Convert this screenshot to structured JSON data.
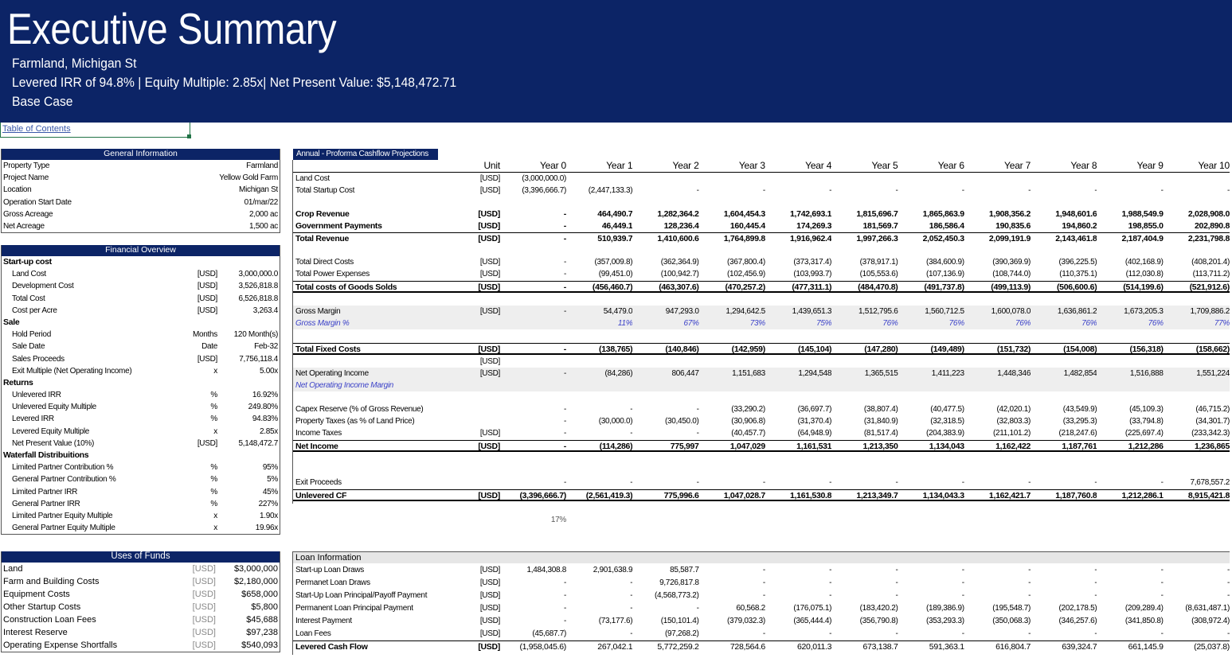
{
  "header": {
    "title": "Executive Summary",
    "location": "Farmland, Michigan St",
    "metrics": "Levered IRR of 94.8% | Equity Multiple: 2.85x| Net Present Value: $5,148,472.71",
    "scenario": "Base Case"
  },
  "toc": {
    "label": "Table of Contents"
  },
  "general": {
    "title": "General Information",
    "rows": [
      {
        "label": "Property Type",
        "value": "Farmland"
      },
      {
        "label": "Project Name",
        "value": "Yellow Gold Farm"
      },
      {
        "label": "Location",
        "value": "Michigan St"
      },
      {
        "label": "Operation Start Date",
        "value": "01/mar/22"
      },
      {
        "label": "Gross Acreage",
        "value": "2,000 ac"
      },
      {
        "label": "Net Acreage",
        "value": "1,500 ac"
      }
    ]
  },
  "financial": {
    "title": "Financial Overview",
    "rows": [
      {
        "label": "Start-up cost",
        "unit": "",
        "value": "",
        "bold": true
      },
      {
        "label": "Land Cost",
        "unit": "[USD]",
        "value": "3,000,000.0"
      },
      {
        "label": "Development Cost",
        "unit": "[USD]",
        "value": "3,526,818.8"
      },
      {
        "label": "Total Cost",
        "unit": "[USD]",
        "value": "6,526,818.8"
      },
      {
        "label": "Cost per Acre",
        "unit": "[USD]",
        "value": "3,263.4"
      },
      {
        "label": "Sale",
        "unit": "",
        "value": "",
        "bold": true
      },
      {
        "label": "Hold Period",
        "unit": "Months",
        "value": "120 Month(s)"
      },
      {
        "label": "Sale Date",
        "unit": "Date",
        "value": "Feb-32"
      },
      {
        "label": "Sales Proceeds",
        "unit": "[USD]",
        "value": "7,756,118.4"
      },
      {
        "label": "Exit Multiple (Net Operating Income)",
        "unit": "x",
        "value": "5.00x"
      },
      {
        "label": "Returns",
        "unit": "",
        "value": "",
        "bold": true
      },
      {
        "label": "Unlevered IRR",
        "unit": "%",
        "value": "16.92%"
      },
      {
        "label": "Unlevered Equity Multiple",
        "unit": "%",
        "value": "249.80%"
      },
      {
        "label": "Levered IRR",
        "unit": "%",
        "value": "94.83%"
      },
      {
        "label": "Levered Equity Multiple",
        "unit": "x",
        "value": "2.85x"
      },
      {
        "label": "Net Present Value (10%)",
        "unit": "[USD]",
        "value": "5,148,472.7"
      },
      {
        "label": "Waterfall Distribuitions",
        "unit": "",
        "value": "",
        "bold": true
      },
      {
        "label": "Limited Partner Contribution %",
        "unit": "%",
        "value": "95%"
      },
      {
        "label": "General Partner Contribution %",
        "unit": "%",
        "value": "5%"
      },
      {
        "label": "Limited Partner IRR",
        "unit": "%",
        "value": "45%"
      },
      {
        "label": "General Partner IRR",
        "unit": "%",
        "value": "227%"
      },
      {
        "label": "Limited Partner Equity Multiple",
        "unit": "x",
        "value": "1.90x"
      },
      {
        "label": "General Partner  Equity Multiple",
        "unit": "x",
        "value": "19.96x"
      }
    ]
  },
  "uses": {
    "title": "Uses of Funds",
    "rows": [
      {
        "label": "Land",
        "unit": "[USD]",
        "value": "$3,000,000"
      },
      {
        "label": "Farm and Building Costs",
        "unit": "[USD]",
        "value": "$2,180,000"
      },
      {
        "label": "Equipment Costs",
        "unit": "[USD]",
        "value": "$658,000"
      },
      {
        "label": "Other Startup Costs",
        "unit": "[USD]",
        "value": "$5,800"
      },
      {
        "label": "Construction Loan Fees",
        "unit": "[USD]",
        "value": "$45,688"
      },
      {
        "label": "Interest Reserve",
        "unit": "[USD]",
        "value": "$97,238"
      },
      {
        "label": "Operating Expense Shortfalls",
        "unit": "[USD]",
        "value": "$540,093"
      }
    ]
  },
  "cashflow": {
    "title": "Annual - Proforma Cashflow Projections",
    "unit_header": "Unit",
    "years": [
      "Year 0",
      "Year 1",
      "Year 2",
      "Year 3",
      "Year 4",
      "Year 5",
      "Year 6",
      "Year 7",
      "Year 8",
      "Year 9",
      "Year 10"
    ],
    "rows": [
      {
        "label": "Land Cost",
        "unit": "[USD]",
        "vals": [
          "(3,000,000.0)",
          "",
          "",
          "",
          "",
          "",
          "",
          "",
          "",
          "",
          ""
        ]
      },
      {
        "label": "Total Startup Cost",
        "unit": "[USD]",
        "vals": [
          "(3,396,666.7)",
          "(2,447,133.3)",
          "-",
          "-",
          "-",
          "-",
          "-",
          "-",
          "-",
          "-",
          "-"
        ]
      },
      {
        "label": "Crop Revenue",
        "unit": "[USD]",
        "bold": true,
        "vals": [
          "-",
          "464,490.7",
          "1,282,364.2",
          "1,604,454.3",
          "1,742,693.1",
          "1,815,696.7",
          "1,865,863.9",
          "1,908,356.2",
          "1,948,601.6",
          "1,988,549.9",
          "2,028,908.0"
        ]
      },
      {
        "label": "Government Payments",
        "unit": "[USD]",
        "bold": true,
        "vals": [
          "-",
          "46,449.1",
          "128,236.4",
          "160,445.4",
          "174,269.3",
          "181,569.7",
          "186,586.4",
          "190,835.6",
          "194,860.2",
          "198,855.0",
          "202,890.8"
        ]
      },
      {
        "label": "Total Revenue",
        "unit": "[USD]",
        "bold": true,
        "vals": [
          "-",
          "510,939.7",
          "1,410,600.6",
          "1,764,899.8",
          "1,916,962.4",
          "1,997,266.3",
          "2,052,450.3",
          "2,099,191.9",
          "2,143,461.8",
          "2,187,404.9",
          "2,231,798.8"
        ]
      },
      {
        "label": "Total Direct Costs",
        "unit": "[USD]",
        "vals": [
          "-",
          "(357,009.8)",
          "(362,364.9)",
          "(367,800.4)",
          "(373,317.4)",
          "(378,917.1)",
          "(384,600.9)",
          "(390,369.9)",
          "(396,225.5)",
          "(402,168.9)",
          "(408,201.4)"
        ]
      },
      {
        "label": "Total Power Expenses",
        "unit": "[USD]",
        "vals": [
          "-",
          "(99,451.0)",
          "(100,942.7)",
          "(102,456.9)",
          "(103,993.7)",
          "(105,553.6)",
          "(107,136.9)",
          "(108,744.0)",
          "(110,375.1)",
          "(112,030.8)",
          "(113,711.2)"
        ]
      },
      {
        "label": "Total costs of Goods Solds",
        "unit": "[USD]",
        "bold": true,
        "vals": [
          "-",
          "(456,460.7)",
          "(463,307.6)",
          "(470,257.2)",
          "(477,311.1)",
          "(484,470.8)",
          "(491,737.8)",
          "(499,113.9)",
          "(506,600.6)",
          "(514,199.6)",
          "(521,912.6)"
        ]
      },
      {
        "label": "Gross Margin",
        "unit": "[USD]",
        "vals": [
          "-",
          "54,479.0",
          "947,293.0",
          "1,294,642.5",
          "1,439,651.3",
          "1,512,795.6",
          "1,560,712.5",
          "1,600,078.0",
          "1,636,861.2",
          "1,673,205.3",
          "1,709,886.2"
        ]
      },
      {
        "label": "Gross Margin %",
        "unit": "",
        "vals": [
          "",
          "11%",
          "67%",
          "73%",
          "75%",
          "76%",
          "76%",
          "76%",
          "76%",
          "76%",
          "77%"
        ]
      },
      {
        "label": "Total Fixed Costs",
        "unit": "[USD]",
        "bold": true,
        "vals": [
          "-",
          "(138,765)",
          "(140,846)",
          "(142,959)",
          "(145,104)",
          "(147,280)",
          "(149,489)",
          "(151,732)",
          "(154,008)",
          "(156,318)",
          "(158,662)"
        ]
      },
      {
        "label": "",
        "unit": "[USD]",
        "vals": [
          "",
          "",
          "",
          "",
          "",
          "",
          "",
          "",
          "",
          "",
          ""
        ]
      },
      {
        "label": "Net Operating Income",
        "unit": "[USD]",
        "vals": [
          "-",
          "(84,286)",
          "806,447",
          "1,151,683",
          "1,294,548",
          "1,365,515",
          "1,411,223",
          "1,448,346",
          "1,482,854",
          "1,516,888",
          "1,551,224"
        ]
      },
      {
        "label": "Net Operating Income Margin",
        "unit": "",
        "vals": [
          "",
          "",
          "",
          "",
          "",
          "",
          "",
          "",
          "",
          "",
          ""
        ]
      },
      {
        "label": "Capex Reserve (% of Gross Revenue)",
        "unit": "",
        "vals": [
          "-",
          "-",
          "-",
          "(33,290.2)",
          "(36,697.7)",
          "(38,807.4)",
          "(40,477.5)",
          "(42,020.1)",
          "(43,549.9)",
          "(45,109.3)",
          "(46,715.2)"
        ]
      },
      {
        "label": "Property Taxes (as % of Land Price)",
        "unit": "",
        "vals": [
          "-",
          "(30,000.0)",
          "(30,450.0)",
          "(30,906.8)",
          "(31,370.4)",
          "(31,840.9)",
          "(32,318.5)",
          "(32,803.3)",
          "(33,295.3)",
          "(33,794.8)",
          "(34,301.7)"
        ]
      },
      {
        "label": "Income Taxes",
        "unit": "[USD]",
        "vals": [
          "-",
          "-",
          "-",
          "(40,457.7)",
          "(64,948.9)",
          "(81,517.4)",
          "(204,383.9)",
          "(211,101.2)",
          "(218,247.6)",
          "(225,697.4)",
          "(233,342.3)"
        ]
      },
      {
        "label": "Net Income",
        "unit": "[USD]",
        "bold": true,
        "vals": [
          "-",
          "(114,286)",
          "775,997",
          "1,047,029",
          "1,161,531",
          "1,213,350",
          "1,134,043",
          "1,162,422",
          "1,187,761",
          "1,212,286",
          "1,236,865"
        ]
      },
      {
        "label": "Exit Proceeds",
        "unit": "",
        "vals": [
          "-",
          "-",
          "-",
          "-",
          "-",
          "-",
          "-",
          "-",
          "-",
          "-",
          "7,678,557.2"
        ]
      },
      {
        "label": "Unlevered CF",
        "unit": "[USD]",
        "bold": true,
        "vals": [
          "(3,396,666.7)",
          "(2,561,419.3)",
          "775,996.6",
          "1,047,028.7",
          "1,161,530.8",
          "1,213,349.7",
          "1,134,043.3",
          "1,162,421.7",
          "1,187,760.8",
          "1,212,286.1",
          "8,915,421.8"
        ]
      }
    ],
    "stray_percent": "17%"
  },
  "loan": {
    "title": "Loan Information",
    "rows": [
      {
        "label": "Start-up Loan Draws",
        "unit": "[USD]",
        "vals": [
          "1,484,308.8",
          "2,901,638.9",
          "85,587.7",
          "-",
          "-",
          "-",
          "-",
          "-",
          "-",
          "-",
          "-"
        ]
      },
      {
        "label": "Permanet Loan Draws",
        "unit": "[USD]",
        "vals": [
          "-",
          "-",
          "9,726,817.8",
          "-",
          "-",
          "-",
          "-",
          "-",
          "-",
          "-",
          "-"
        ]
      },
      {
        "label": "Start-Up Loan Principal/Payoff Payment",
        "unit": "[USD]",
        "vals": [
          "-",
          "-",
          "(4,568,773.2)",
          "-",
          "-",
          "-",
          "-",
          "-",
          "-",
          "-",
          "-"
        ]
      },
      {
        "label": "Permanent Loan Principal Payment",
        "unit": "[USD]",
        "vals": [
          "-",
          "-",
          "-",
          "60,568.2",
          "(176,075.1)",
          "(183,420.2)",
          "(189,386.9)",
          "(195,548.7)",
          "(202,178.5)",
          "(209,289.4)",
          "(8,631,487.1)"
        ]
      },
      {
        "label": "Interest Payment",
        "unit": "[USD]",
        "vals": [
          "-",
          "(73,177.6)",
          "(150,101.4)",
          "(379,032.3)",
          "(365,444.4)",
          "(356,790.8)",
          "(353,293.3)",
          "(350,068.3)",
          "(346,257.6)",
          "(341,850.8)",
          "(308,972.4)"
        ]
      },
      {
        "label": "Loan Fees",
        "unit": "[USD]",
        "vals": [
          "(45,687.7)",
          "-",
          "(97,268.2)",
          "-",
          "-",
          "-",
          "-",
          "-",
          "-",
          "-",
          "-"
        ]
      },
      {
        "label": "Levered Cash Flow",
        "unit": "[USD]",
        "bold": true,
        "vals": [
          "(1,958,045.6)",
          "267,042.1",
          "5,772,259.2",
          "728,564.6",
          "620,011.3",
          "673,138.7",
          "591,363.1",
          "616,804.7",
          "639,324.7",
          "661,145.9",
          "(25,037.8)"
        ]
      }
    ]
  },
  "colors": {
    "header_bg": "#0c2466",
    "margin_blue": "#3c42c8",
    "grid_green": "#217346"
  }
}
